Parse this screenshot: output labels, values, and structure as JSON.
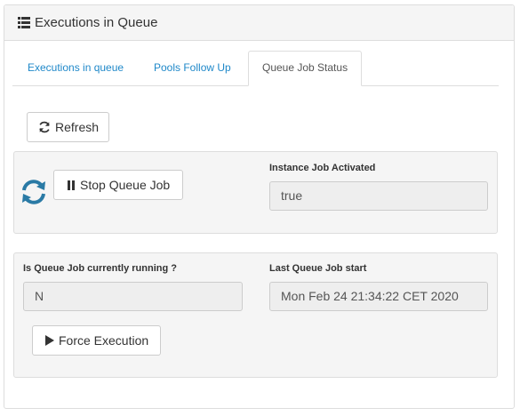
{
  "panel": {
    "title": "Executions in Queue",
    "icon": "list-icon"
  },
  "tabs": [
    {
      "label": "Executions in queue",
      "active": false
    },
    {
      "label": "Pools Follow Up",
      "active": false
    },
    {
      "label": "Queue Job Status",
      "active": true
    }
  ],
  "toolbar": {
    "refresh_label": "Refresh"
  },
  "job_control": {
    "stop_label": "Stop Queue Job",
    "status_icon": "sync-icon",
    "instance_label": "Instance Job Activated",
    "instance_value": "true"
  },
  "job_status": {
    "running_label": "Is Queue Job currently running ?",
    "running_value": "N",
    "last_start_label": "Last Queue Job start",
    "last_start_value": "Mon Feb 24 21:34:22 CET 2020",
    "force_label": "Force Execution"
  },
  "colors": {
    "accent": "#1f88c9",
    "sync_icon": "#2a7aa5"
  }
}
